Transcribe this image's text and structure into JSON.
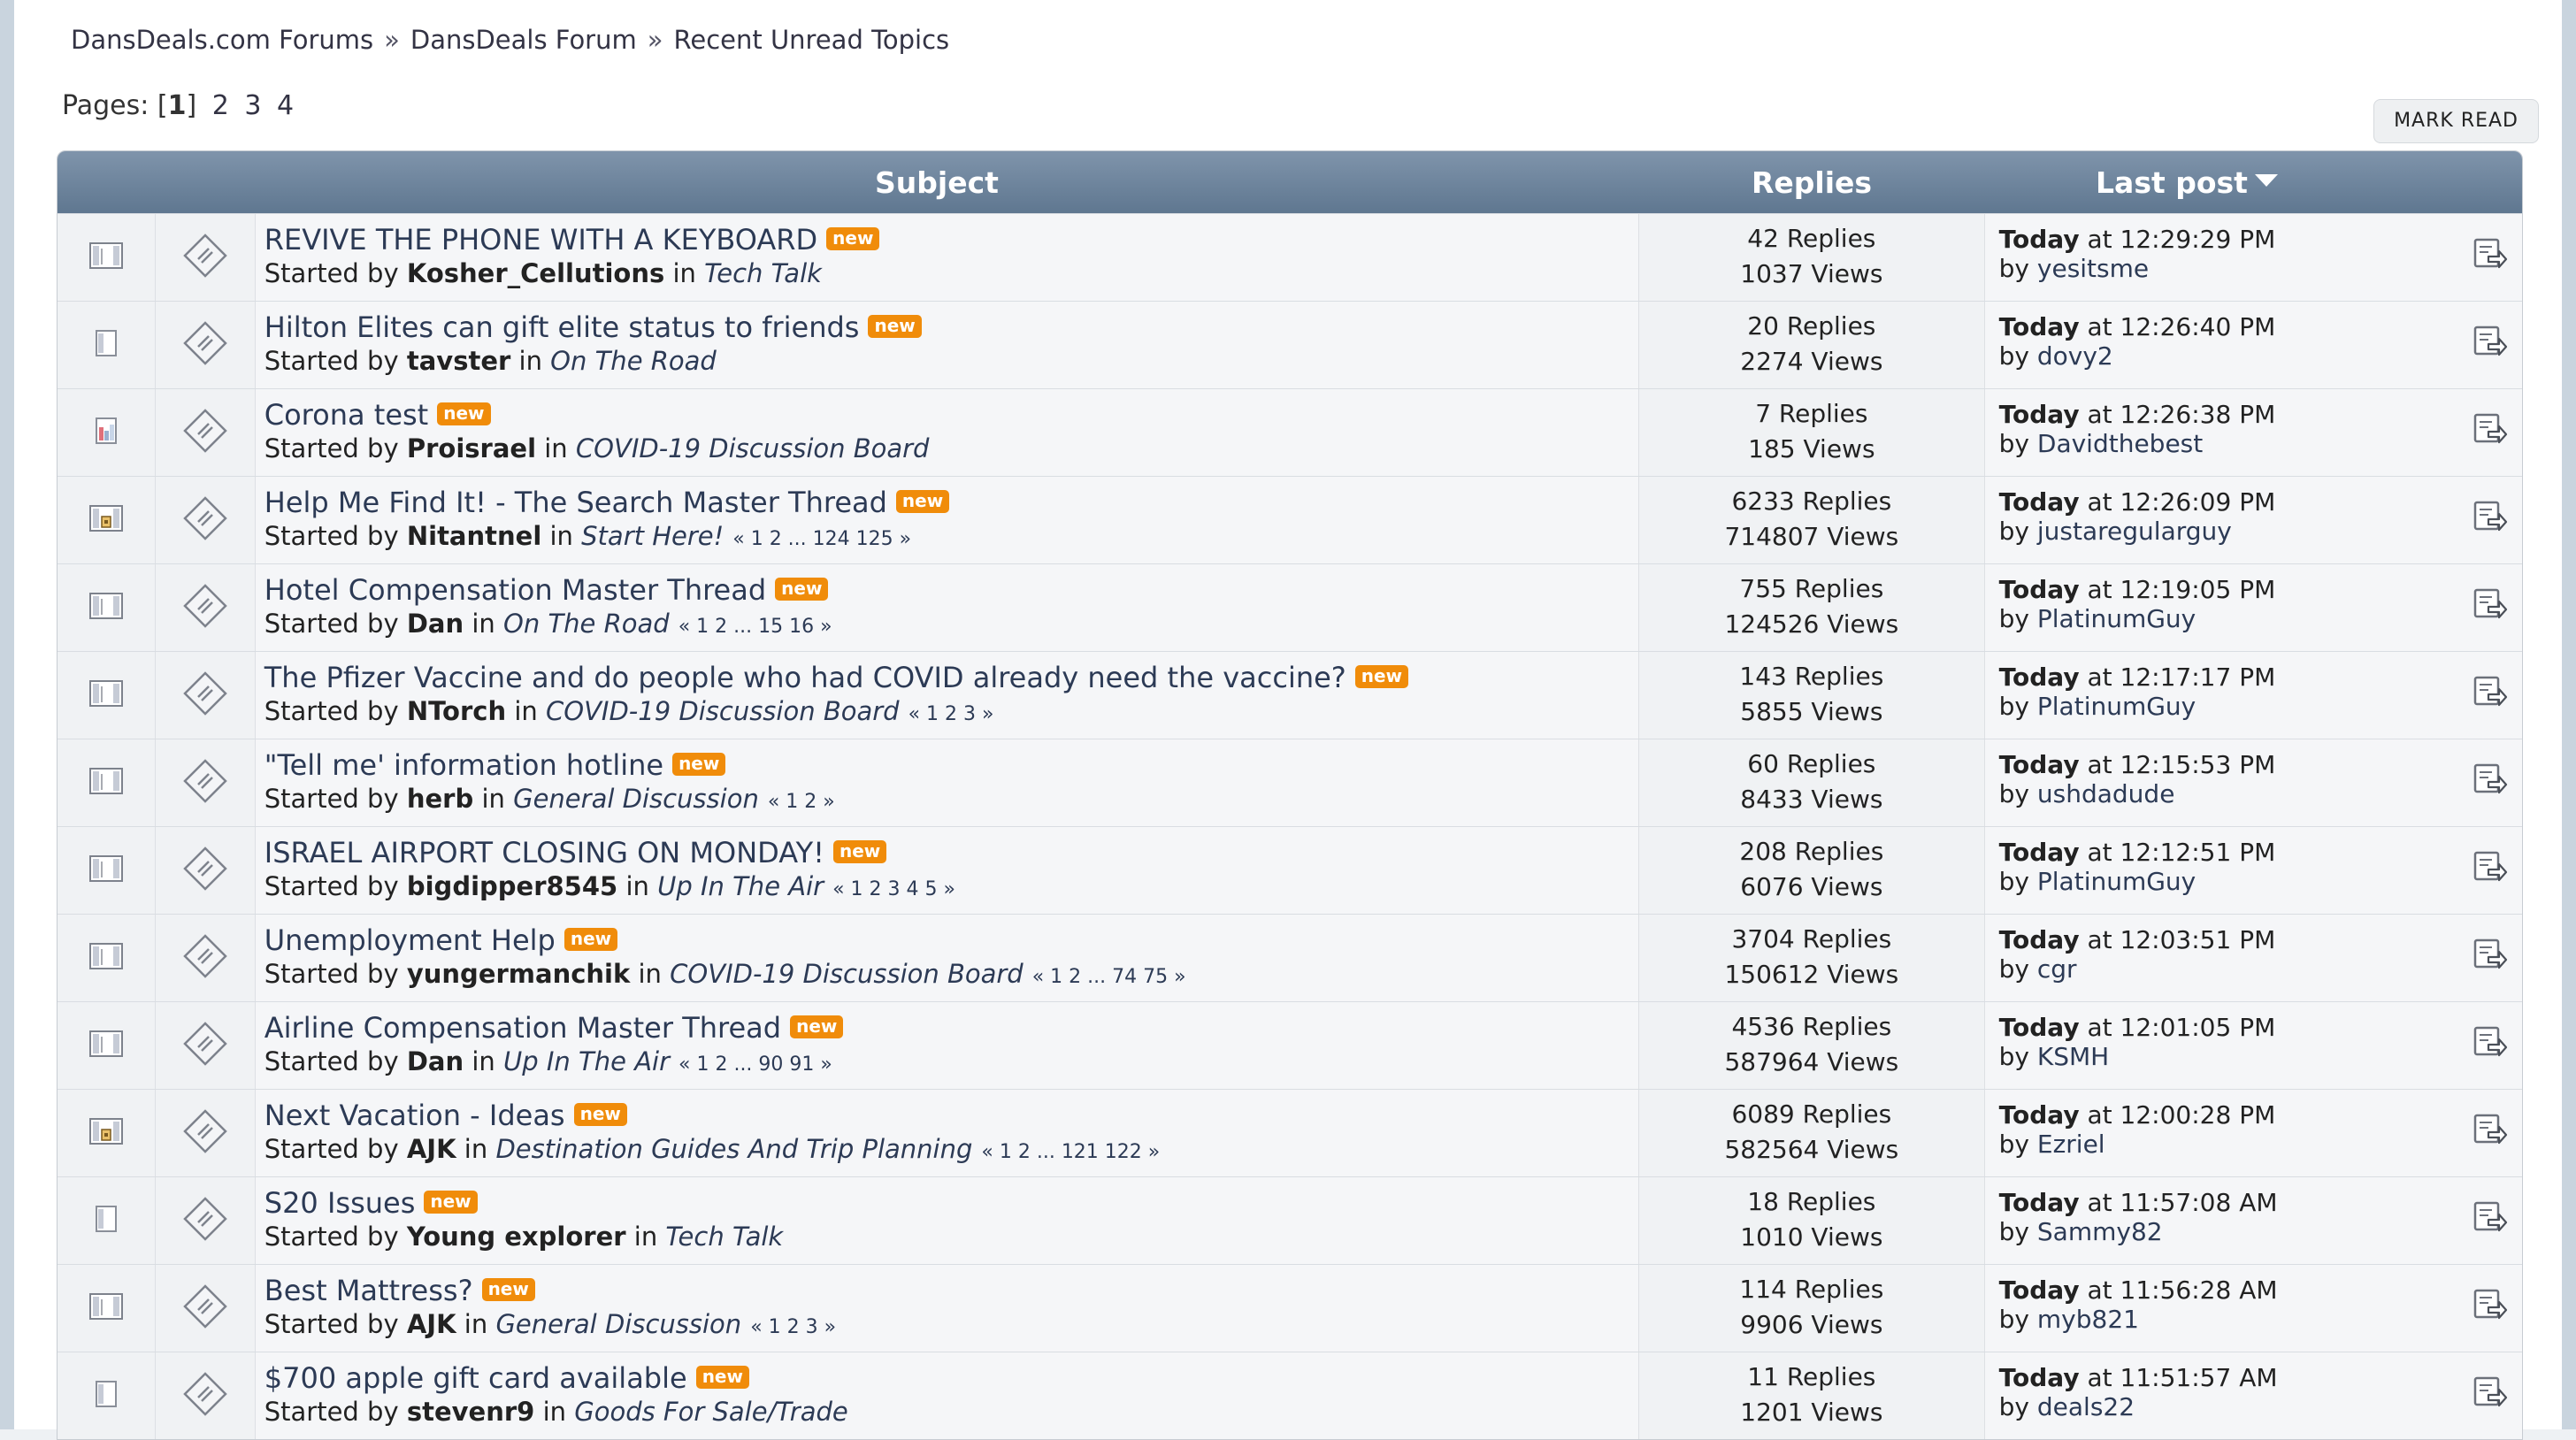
{
  "breadcrumb": [
    "DansDeals.com Forums",
    "DansDeals Forum",
    "Recent Unread Topics"
  ],
  "pages": {
    "label": "Pages:",
    "current": "1",
    "others": [
      "2",
      "3",
      "4"
    ]
  },
  "mark_read": "MARK READ",
  "headers": {
    "subject": "Subject",
    "replies": "Replies",
    "last_post": "Last post"
  },
  "new_badge": "new",
  "strings": {
    "started_by": "Started by",
    "in": "in",
    "by": "by"
  },
  "topics": [
    {
      "title": "REVIVE THE PHONE WITH A KEYBOARD",
      "author": "Kosher_Cellutions",
      "board": "Tech Talk",
      "pages": "",
      "replies": "42 Replies",
      "views": "1037 Views",
      "day": "Today",
      "time": "at 12:29:29 PM",
      "last_by": "yesitsme",
      "icon": "normal"
    },
    {
      "title": "Hilton Elites can gift elite status to friends",
      "author": "tavster",
      "board": "On The Road",
      "pages": "",
      "replies": "20 Replies",
      "views": "2274 Views",
      "day": "Today",
      "time": "at 12:26:40 PM",
      "last_by": "dovy2",
      "icon": "small"
    },
    {
      "title": "Corona test",
      "author": "Proisrael",
      "board": "COVID-19 Discussion Board",
      "pages": "",
      "replies": "7 Replies",
      "views": "185 Views",
      "day": "Today",
      "time": "at 12:26:38 PM",
      "last_by": "Davidthebest",
      "icon": "poll"
    },
    {
      "title": "Help Me Find It! - The Search Master Thread",
      "author": "Nitantnel",
      "board": "Start Here!",
      "pages": "« 1 2 ... 124 125 »",
      "replies": "6233 Replies",
      "views": "714807 Views",
      "day": "Today",
      "time": "at 12:26:09 PM",
      "last_by": "justaregularguy",
      "icon": "sticky"
    },
    {
      "title": "Hotel Compensation Master Thread",
      "author": "Dan",
      "board": "On The Road",
      "pages": "« 1 2 ... 15 16 »",
      "replies": "755 Replies",
      "views": "124526 Views",
      "day": "Today",
      "time": "at 12:19:05 PM",
      "last_by": "PlatinumGuy",
      "icon": "normal"
    },
    {
      "title": "The Pfizer Vaccine and do people who had COVID already need the vaccine?",
      "author": "NTorch",
      "board": "COVID-19 Discussion Board",
      "pages": "« 1 2 3 »",
      "replies": "143 Replies",
      "views": "5855 Views",
      "day": "Today",
      "time": "at 12:17:17 PM",
      "last_by": "PlatinumGuy",
      "icon": "normal"
    },
    {
      "title": "\"Tell me' information hotline",
      "author": "herb",
      "board": "General Discussion",
      "pages": "« 1 2 »",
      "replies": "60 Replies",
      "views": "8433 Views",
      "day": "Today",
      "time": "at 12:15:53 PM",
      "last_by": "ushdadude",
      "icon": "normal"
    },
    {
      "title": "ISRAEL AIRPORT CLOSING ON MONDAY!",
      "author": "bigdipper8545",
      "board": "Up In The Air",
      "pages": "« 1 2 3 4 5 »",
      "replies": "208 Replies",
      "views": "6076 Views",
      "day": "Today",
      "time": "at 12:12:51 PM",
      "last_by": "PlatinumGuy",
      "icon": "normal"
    },
    {
      "title": "Unemployment Help",
      "author": "yungermanchik",
      "board": "COVID-19 Discussion Board",
      "pages": "« 1 2 ... 74 75 »",
      "replies": "3704 Replies",
      "views": "150612 Views",
      "day": "Today",
      "time": "at 12:03:51 PM",
      "last_by": "cgr",
      "icon": "normal"
    },
    {
      "title": "Airline Compensation Master Thread",
      "author": "Dan",
      "board": "Up In The Air",
      "pages": "« 1 2 ... 90 91 »",
      "replies": "4536 Replies",
      "views": "587964 Views",
      "day": "Today",
      "time": "at 12:01:05 PM",
      "last_by": "KSMH",
      "icon": "normal"
    },
    {
      "title": "Next Vacation - Ideas",
      "author": "AJK",
      "board": "Destination Guides And Trip Planning",
      "pages": "« 1 2 ... 121 122 »",
      "replies": "6089 Replies",
      "views": "582564 Views",
      "day": "Today",
      "time": "at 12:00:28 PM",
      "last_by": "Ezriel",
      "icon": "sticky"
    },
    {
      "title": "S20 Issues",
      "author": "Young explorer",
      "board": "Tech Talk",
      "pages": "",
      "replies": "18 Replies",
      "views": "1010 Views",
      "day": "Today",
      "time": "at 11:57:08 AM",
      "last_by": "Sammy82",
      "icon": "small"
    },
    {
      "title": "Best Mattress?",
      "author": "AJK",
      "board": "General Discussion",
      "pages": "« 1 2 3 »",
      "replies": "114 Replies",
      "views": "9906 Views",
      "day": "Today",
      "time": "at 11:56:28 AM",
      "last_by": "myb821",
      "icon": "normal"
    },
    {
      "title": "$700 apple gift card available",
      "author": "stevenr9",
      "board": "Goods For Sale/Trade",
      "pages": "",
      "replies": "11 Replies",
      "views": "1201 Views",
      "day": "Today",
      "time": "at 11:51:57 AM",
      "last_by": "deals22",
      "icon": "small"
    }
  ]
}
